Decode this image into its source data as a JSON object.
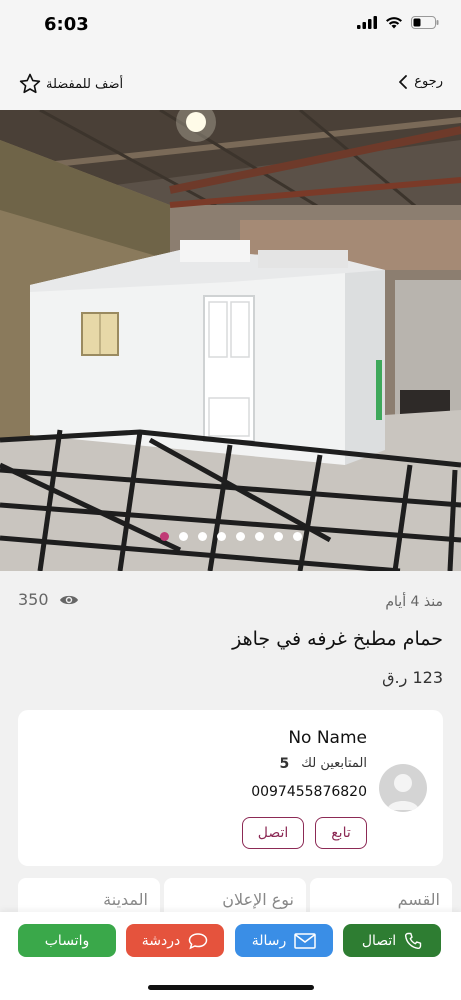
{
  "status_bar": {
    "time": "6:03"
  },
  "nav": {
    "favorite_label": "أضف للمفضلة",
    "back_label": "رجوع"
  },
  "gallery": {
    "dot_count": 8,
    "active_index": 0
  },
  "listing": {
    "posted": "منذ 4 أيام",
    "views": "350",
    "title": "حمام مطبخ غرفه في جاهز",
    "price": "123 ر.ق"
  },
  "seller": {
    "name": "No Name",
    "followers_label": "المتابعين لك",
    "followers_count": "5",
    "phone": "0097455876820",
    "follow_label": "تابع",
    "contact_label": "اتصل"
  },
  "details": {
    "category_label": "القسم",
    "ad_type_label": "نوع الإعلان",
    "city_label": "المدينة"
  },
  "actions": {
    "call_label": "اتصال",
    "message_label": "رسالة",
    "chat_label": "دردشة",
    "whatsapp_label": "واتساب"
  },
  "colors": {
    "accent": "#8c2a55",
    "call": "#2e7d32",
    "message": "#3a8ee6",
    "chat": "#e5533d",
    "whatsapp": "#3aa84a"
  }
}
